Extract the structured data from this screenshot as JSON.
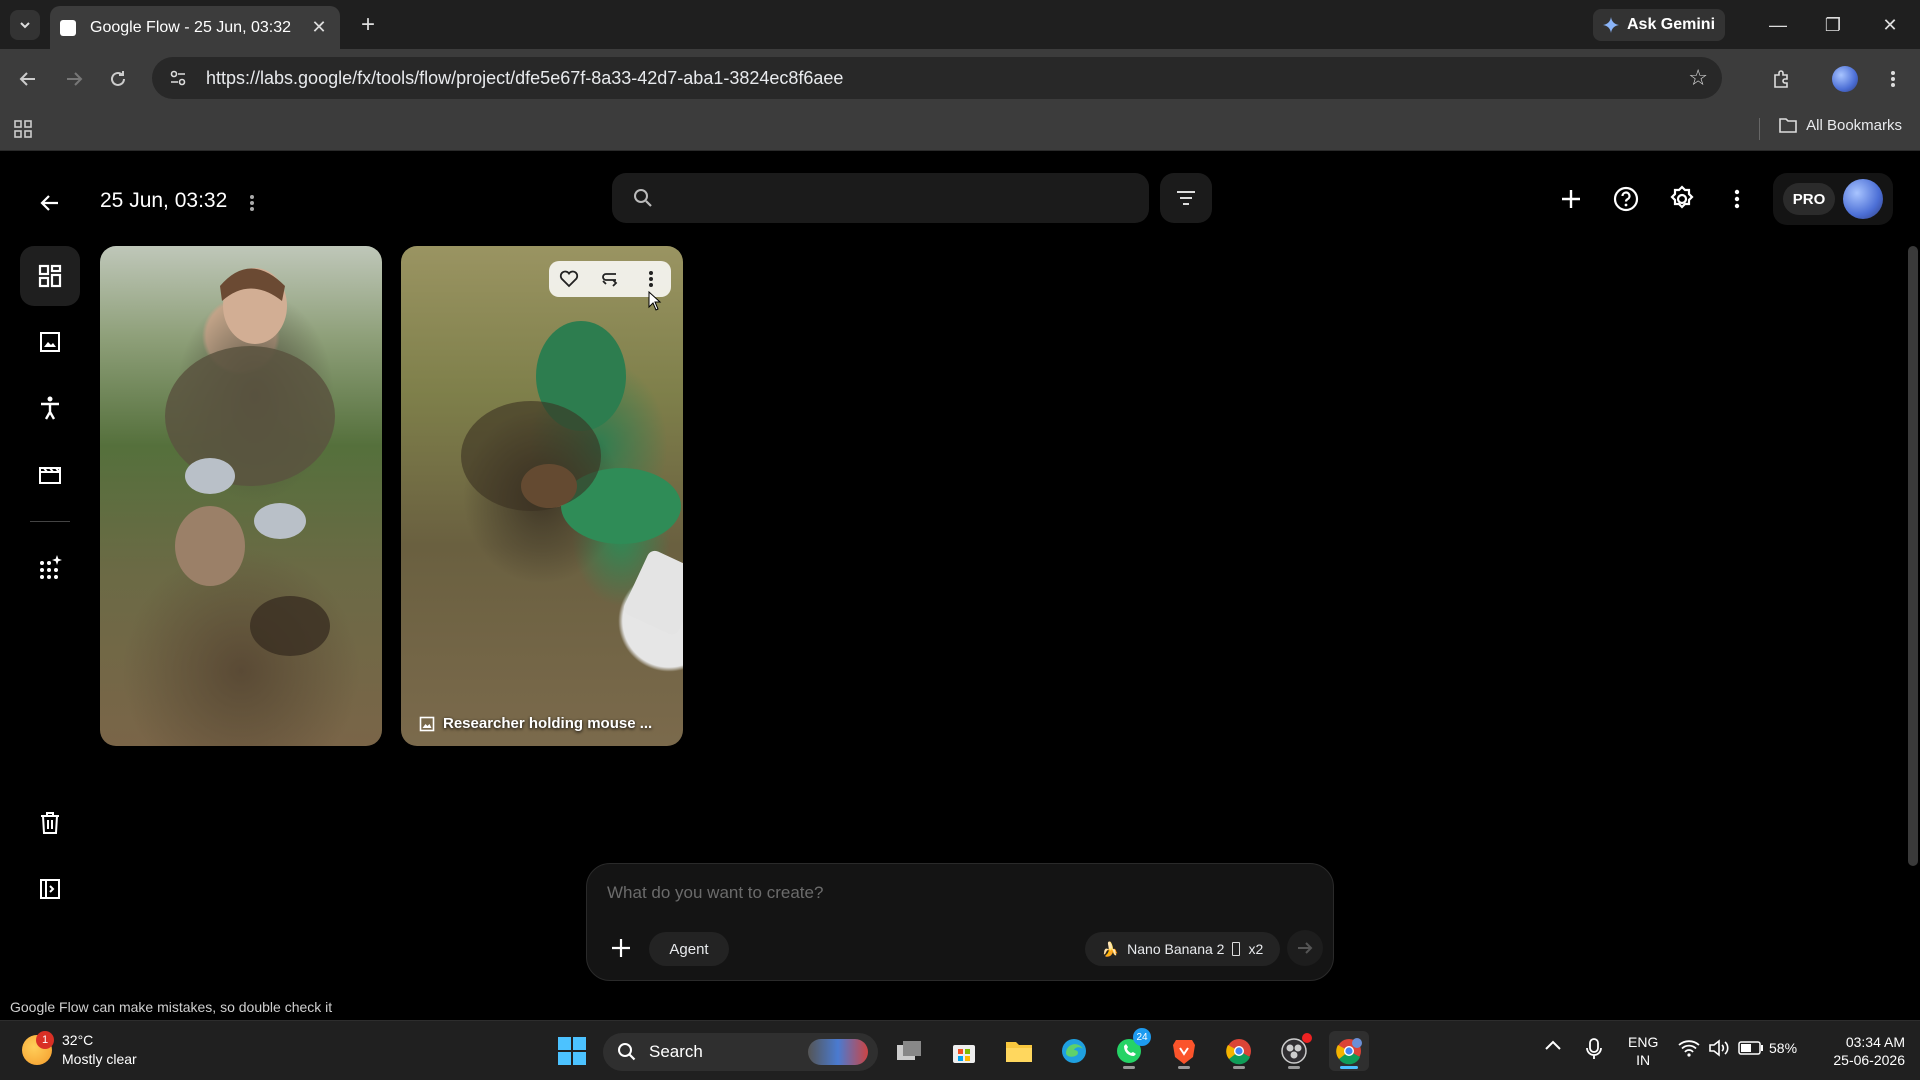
{
  "browser": {
    "tab_title": "Google Flow - 25 Jun, 03:32",
    "ask_gemini": "Ask Gemini",
    "url": "https://labs.google/fx/tools/flow/project/dfe5e67f-8a33-42d7-aba1-3824ec8f6aee",
    "all_bookmarks": "All Bookmarks"
  },
  "app": {
    "project_title": "25 Jun, 03:32",
    "search_placeholder": "",
    "pro_label": "PRO",
    "sidebar": [
      {
        "name": "grid-view",
        "icon": "grid-icon"
      },
      {
        "name": "images",
        "icon": "image-icon"
      },
      {
        "name": "characters",
        "icon": "figure-icon"
      },
      {
        "name": "scenes",
        "icon": "clapper-icon"
      },
      {
        "name": "tools",
        "icon": "sparkle-grid-icon"
      },
      {
        "name": "trash",
        "icon": "trash-icon"
      },
      {
        "name": "collapse-panel",
        "icon": "panel-icon"
      }
    ],
    "cards": [
      {
        "caption": ""
      },
      {
        "caption": "Researcher holding mouse ..."
      }
    ],
    "composer": {
      "placeholder": "What do you want to create?",
      "agent_label": "Agent",
      "model_label": "Nano Banana 2",
      "count_label": "x2"
    },
    "disclaimer": "Google Flow can make mistakes, so double check it"
  },
  "taskbar": {
    "temperature": "32°C",
    "condition": "Mostly clear",
    "weather_badge": "1",
    "search_label": "Search",
    "whatsapp_badge": "24",
    "lang_top": "ENG",
    "lang_bottom": "IN",
    "battery": "58%",
    "time": "03:34 AM",
    "date": "25-06-2026"
  }
}
